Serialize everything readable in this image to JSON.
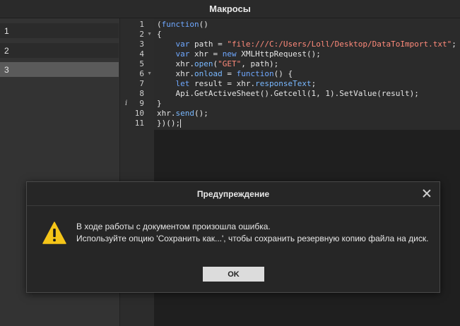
{
  "window": {
    "title": "Макросы"
  },
  "sidebar": {
    "items": [
      {
        "label": "1",
        "selected": false
      },
      {
        "label": "2",
        "selected": false
      },
      {
        "label": "3",
        "selected": true
      }
    ]
  },
  "editor": {
    "line_numbers": [
      "1",
      "2",
      "3",
      "4",
      "5",
      "6",
      "7",
      "8",
      "9",
      "10",
      "11"
    ],
    "info_marker": "i",
    "lines": [
      [
        {
          "t": "(",
          "c": ""
        },
        {
          "t": "function",
          "c": "kw"
        },
        {
          "t": "()",
          "c": ""
        }
      ],
      [
        {
          "t": "{",
          "c": ""
        }
      ],
      [
        {
          "t": "    ",
          "c": ""
        },
        {
          "t": "var",
          "c": "kw"
        },
        {
          "t": " path = ",
          "c": ""
        },
        {
          "t": "\"file:///C:/Users/Loll/Desktop/DataToImport.txt\"",
          "c": "str"
        },
        {
          "t": ";",
          "c": ""
        }
      ],
      [
        {
          "t": "    ",
          "c": ""
        },
        {
          "t": "var",
          "c": "kw"
        },
        {
          "t": " xhr = ",
          "c": ""
        },
        {
          "t": "new",
          "c": "kw"
        },
        {
          "t": " XMLHttpRequest();",
          "c": ""
        }
      ],
      [
        {
          "t": "    xhr.",
          "c": ""
        },
        {
          "t": "open",
          "c": "prop"
        },
        {
          "t": "(",
          "c": ""
        },
        {
          "t": "\"GET\"",
          "c": "str"
        },
        {
          "t": ", path);",
          "c": ""
        }
      ],
      [
        {
          "t": "    xhr.",
          "c": ""
        },
        {
          "t": "onload",
          "c": "prop"
        },
        {
          "t": " = ",
          "c": ""
        },
        {
          "t": "function",
          "c": "kw"
        },
        {
          "t": "() {",
          "c": ""
        }
      ],
      [
        {
          "t": "    ",
          "c": ""
        },
        {
          "t": "let",
          "c": "kw"
        },
        {
          "t": " result = xhr.",
          "c": ""
        },
        {
          "t": "responseText",
          "c": "prop"
        },
        {
          "t": ";",
          "c": ""
        }
      ],
      [
        {
          "t": "    Api.GetActiveSheet().Getcell(1, 1).SetValue(result);",
          "c": ""
        }
      ],
      [
        {
          "t": "}",
          "c": ""
        }
      ],
      [
        {
          "t": "xhr.",
          "c": ""
        },
        {
          "t": "send",
          "c": "prop"
        },
        {
          "t": "();",
          "c": ""
        }
      ],
      [
        {
          "t": "})();",
          "c": ""
        }
      ]
    ]
  },
  "dialog": {
    "title": "Предупреждение",
    "message_line1": "В ходе работы с документом произошла ошибка.",
    "message_line2": "Используйте опцию 'Сохранить как...', чтобы сохранить резервную копию файла на диск.",
    "ok_label": "OK",
    "icon": "warning-icon",
    "icon_color": "#f5c518"
  }
}
